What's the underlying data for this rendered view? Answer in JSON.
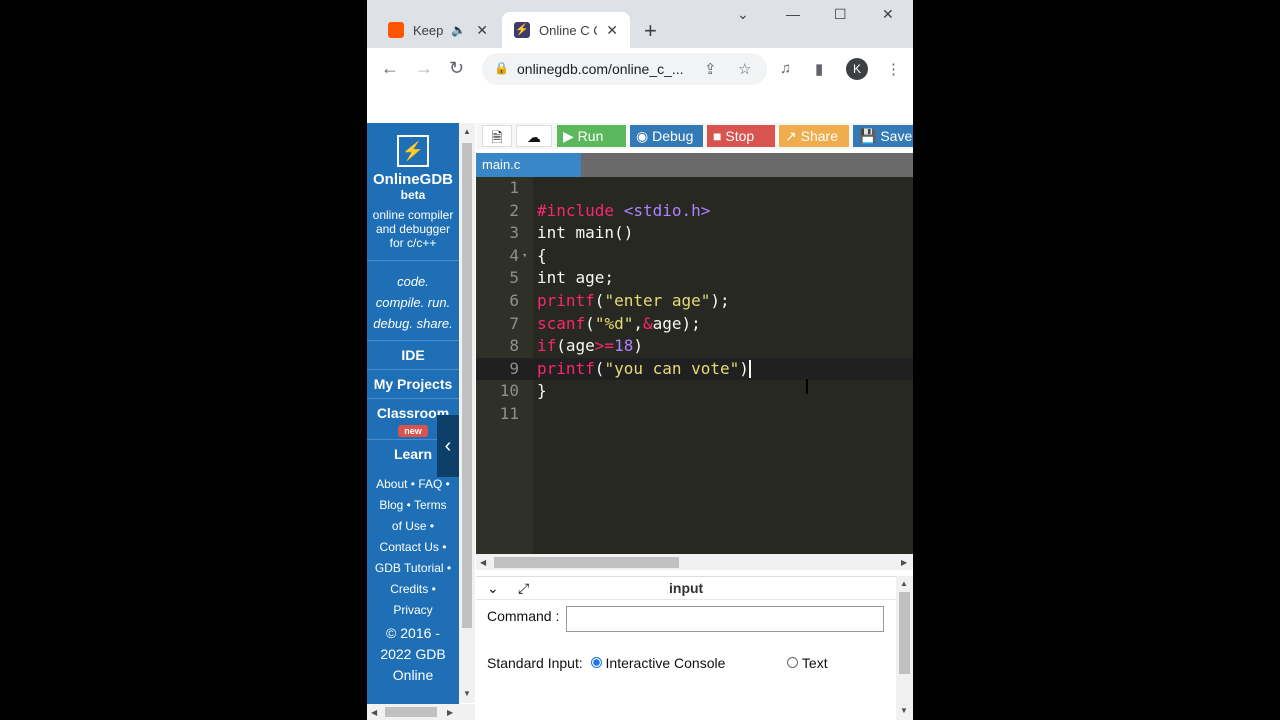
{
  "browser": {
    "tabs": [
      {
        "title": "Keep C",
        "audio_icon": "speaker-icon",
        "favicon": "soundcloud-icon"
      },
      {
        "title": "Online C C",
        "favicon": "onlinegdb-icon"
      }
    ],
    "new_tab": "+",
    "window_controls": {
      "dropdown": "⌄",
      "minimize": "—",
      "maximize": "☐",
      "close": "✕"
    },
    "url": "onlinegdb.com/online_c_...",
    "profile_initial": "K"
  },
  "sidebar": {
    "brand": "OnlineGDB",
    "beta": "beta",
    "tagline": "online compiler and debugger for c/c++",
    "motto": [
      "code.",
      "compile. run.",
      "debug. share."
    ],
    "nav": [
      "IDE",
      "My Projects",
      "Classroom",
      "Learn"
    ],
    "badge": "new",
    "links": [
      "About •  FAQ •",
      "Blog • Terms",
      "of Use •",
      "Contact Us •",
      "GDB Tutorial •",
      "Credits •",
      "Privacy"
    ],
    "copyright": [
      "© 2016 -",
      "2022 GDB",
      "Online"
    ]
  },
  "menu": {
    "run": "Run",
    "debug": "Debug",
    "stop": "Stop",
    "share": "Share",
    "save": "Save",
    "colors": {
      "run": "#5cb85c",
      "debug": "#337ab7",
      "stop": "#d9534f",
      "share": "#f0ad4e",
      "save": "#337ab7"
    }
  },
  "editor": {
    "file_tab": "main.c",
    "lines": [
      "1",
      "2",
      "3",
      "4",
      "5",
      "6",
      "7",
      "8",
      "9",
      "10",
      "11"
    ],
    "code": {
      "l2_pp": "#include",
      "l2_hdr": "<stdio.h>",
      "l3": "int main()",
      "l4": "{",
      "l5": "int age;",
      "l6_fn": "printf",
      "l6_a": "(",
      "l6_str": "\"enter age\"",
      "l6_b": ");",
      "l7_fn": "scanf",
      "l7_a": "(",
      "l7_str": "\"%d\"",
      "l7_c": ",",
      "l7_amp": "&",
      "l7_b": "age);",
      "l8_fn": "if",
      "l8_a": "(age",
      "l8_op": ">=",
      "l8_num": "18",
      "l8_b": ")",
      "l9_fn": "printf",
      "l9_a": "(",
      "l9_str": "\"you can vote\"",
      "l9_b": ")",
      "l10": "}"
    }
  },
  "io": {
    "title": "input",
    "command_label": "Command :",
    "command_value": "",
    "stdin_label": "Standard Input:",
    "option_interactive": "Interactive Console",
    "option_text": "Text"
  }
}
